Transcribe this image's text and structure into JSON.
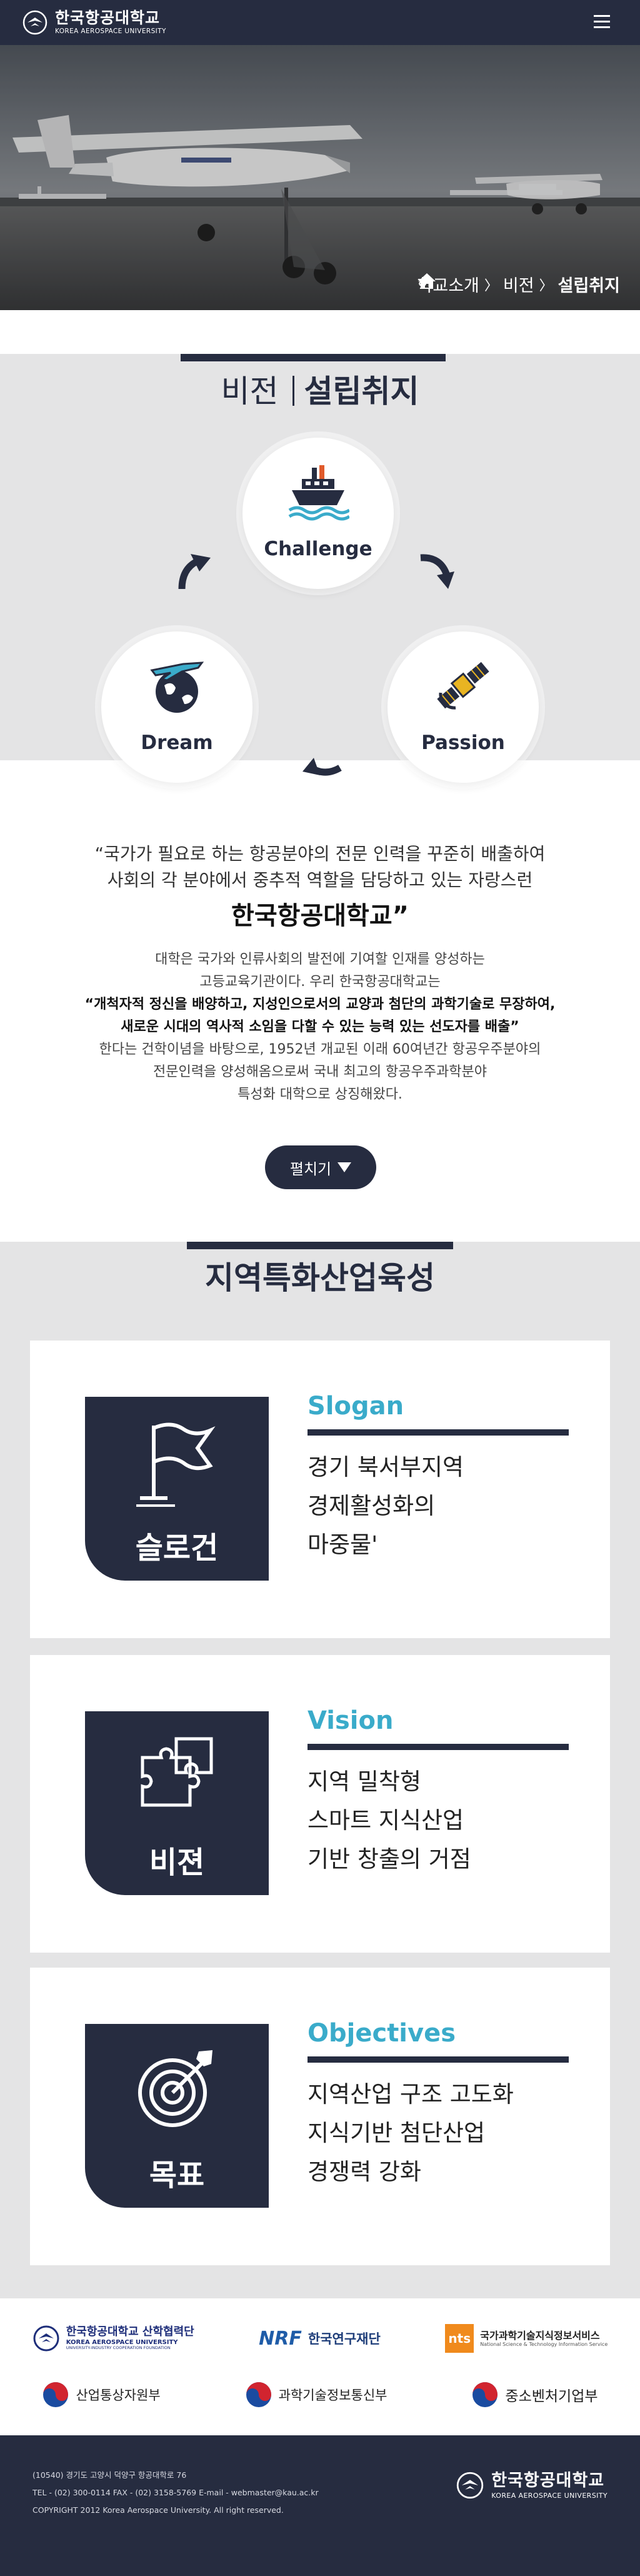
{
  "header": {
    "logo_ko": "한국항공대학교",
    "logo_en": "KOREA AEROSPACE UNIVERSITY",
    "menu_icon": "hamburger-icon"
  },
  "breadcrumb": {
    "home_icon": "home-icon",
    "items": [
      "학교소개",
      "비전",
      "설립취지"
    ]
  },
  "vision": {
    "title_main": "비전",
    "title_sub": "설립취지",
    "circles": [
      {
        "label": "Challenge",
        "icon": "ship-icon"
      },
      {
        "label": "Dream",
        "icon": "airplane-globe-icon"
      },
      {
        "label": "Passion",
        "icon": "satellite-icon"
      }
    ]
  },
  "intro": {
    "quote_line1": "“국가가 필요로 하는 항공분야의 전문 인력을 꾸준히 배출하여",
    "quote_line2": "사회의 각 분야에서 중추적 역할을 담당하고 있는 자랑스런",
    "university": "한국항공대학교”",
    "desc_line1": "대학은 국가와 인류사회의 발전에 기여할 인재를 양성하는",
    "desc_line2": "고등교육기관이다. 우리 한국항공대학교는",
    "desc_bold1": "“개척자적 정신을 배양하고, 지성인으로서의 교양과 첨단의 과학기술로 무장하여,",
    "desc_bold2": "새로운 시대의 역사적 소임을 다할 수 있는 능력 있는 선도자를 배출”",
    "desc_line3": "한다는 건학이념을 바탕으로, 1952년 개교된 이래 60여년간 항공우주분야의",
    "desc_line4": "전문인력을 양성해옴으로써 국내 최고의 항공우주과학분야",
    "desc_line5": "특성화 대학으로 상징해왔다.",
    "expand_label": "펼치기"
  },
  "region": {
    "title": "지역특화산업육성",
    "cards": [
      {
        "tile_label": "슬로건",
        "icon": "flag-icon",
        "heading": "Slogan",
        "lines": [
          "경기 북서부지역",
          "경제활성화의",
          "마중물'"
        ]
      },
      {
        "tile_label": "비젼",
        "icon": "puzzle-icon",
        "heading": "Vision",
        "lines": [
          "지역 밀착형",
          "스마트 지식산업",
          "기반 창출의 거점"
        ]
      },
      {
        "tile_label": "목표",
        "icon": "target-icon",
        "heading": "Objectives",
        "lines": [
          "지역산업 구조 고도화",
          "지식기반 첨단산업",
          "경쟁력 강화"
        ]
      }
    ]
  },
  "partners": {
    "kau_ko": "한국항공대학교 산학협력단",
    "kau_en": "KOREA AEROSPACE UNIVERSITY",
    "kau_en2": "UNIVERSITY-INDUSTRY COOPERATION FOUNDATION",
    "nrf_mark": "NRF",
    "nrf_name": "한국연구재단",
    "ntis_mark": "nts",
    "ntis_name": "국가과학기술지식정보서비스",
    "ntis_en": "National Science & Technology Information Service",
    "gov1": "산업통상자원부",
    "gov2": "과학기술정보통신부",
    "gov3": "중소벤처기업부"
  },
  "footer": {
    "address": "(10540) 경기도 고양시 덕양구 항공대학로 76",
    "contact": "TEL - (02) 300-0114  FAX - (02) 3158-5769 E-mail - webmaster@kau.ac.kr",
    "copyright": "COPYRIGHT 2012 Korea Aerospace University. All right reserved.",
    "logo_ko": "한국항공대학교",
    "logo_en": "KOREA AEROSPACE UNIVERSITY"
  },
  "colors": {
    "navy": "#262c40",
    "accent": "#3aabca",
    "band_gray": "#e4e4e5"
  }
}
